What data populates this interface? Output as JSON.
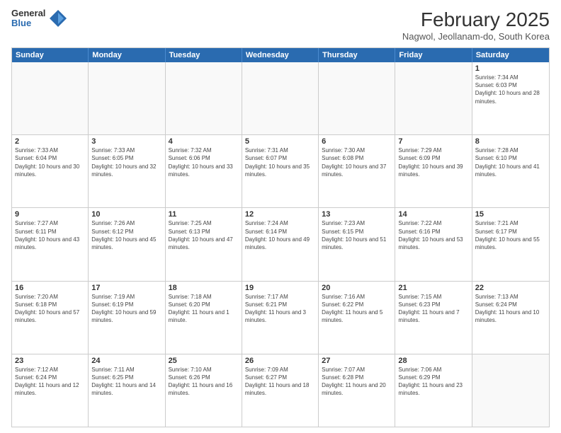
{
  "header": {
    "logo": {
      "general": "General",
      "blue": "Blue"
    },
    "title": "February 2025",
    "location": "Nagwol, Jeollanam-do, South Korea"
  },
  "calendar": {
    "weekdays": [
      "Sunday",
      "Monday",
      "Tuesday",
      "Wednesday",
      "Thursday",
      "Friday",
      "Saturday"
    ],
    "rows": [
      [
        {
          "day": "",
          "info": ""
        },
        {
          "day": "",
          "info": ""
        },
        {
          "day": "",
          "info": ""
        },
        {
          "day": "",
          "info": ""
        },
        {
          "day": "",
          "info": ""
        },
        {
          "day": "",
          "info": ""
        },
        {
          "day": "1",
          "info": "Sunrise: 7:34 AM\nSunset: 6:03 PM\nDaylight: 10 hours and 28 minutes."
        }
      ],
      [
        {
          "day": "2",
          "info": "Sunrise: 7:33 AM\nSunset: 6:04 PM\nDaylight: 10 hours and 30 minutes."
        },
        {
          "day": "3",
          "info": "Sunrise: 7:33 AM\nSunset: 6:05 PM\nDaylight: 10 hours and 32 minutes."
        },
        {
          "day": "4",
          "info": "Sunrise: 7:32 AM\nSunset: 6:06 PM\nDaylight: 10 hours and 33 minutes."
        },
        {
          "day": "5",
          "info": "Sunrise: 7:31 AM\nSunset: 6:07 PM\nDaylight: 10 hours and 35 minutes."
        },
        {
          "day": "6",
          "info": "Sunrise: 7:30 AM\nSunset: 6:08 PM\nDaylight: 10 hours and 37 minutes."
        },
        {
          "day": "7",
          "info": "Sunrise: 7:29 AM\nSunset: 6:09 PM\nDaylight: 10 hours and 39 minutes."
        },
        {
          "day": "8",
          "info": "Sunrise: 7:28 AM\nSunset: 6:10 PM\nDaylight: 10 hours and 41 minutes."
        }
      ],
      [
        {
          "day": "9",
          "info": "Sunrise: 7:27 AM\nSunset: 6:11 PM\nDaylight: 10 hours and 43 minutes."
        },
        {
          "day": "10",
          "info": "Sunrise: 7:26 AM\nSunset: 6:12 PM\nDaylight: 10 hours and 45 minutes."
        },
        {
          "day": "11",
          "info": "Sunrise: 7:25 AM\nSunset: 6:13 PM\nDaylight: 10 hours and 47 minutes."
        },
        {
          "day": "12",
          "info": "Sunrise: 7:24 AM\nSunset: 6:14 PM\nDaylight: 10 hours and 49 minutes."
        },
        {
          "day": "13",
          "info": "Sunrise: 7:23 AM\nSunset: 6:15 PM\nDaylight: 10 hours and 51 minutes."
        },
        {
          "day": "14",
          "info": "Sunrise: 7:22 AM\nSunset: 6:16 PM\nDaylight: 10 hours and 53 minutes."
        },
        {
          "day": "15",
          "info": "Sunrise: 7:21 AM\nSunset: 6:17 PM\nDaylight: 10 hours and 55 minutes."
        }
      ],
      [
        {
          "day": "16",
          "info": "Sunrise: 7:20 AM\nSunset: 6:18 PM\nDaylight: 10 hours and 57 minutes."
        },
        {
          "day": "17",
          "info": "Sunrise: 7:19 AM\nSunset: 6:19 PM\nDaylight: 10 hours and 59 minutes."
        },
        {
          "day": "18",
          "info": "Sunrise: 7:18 AM\nSunset: 6:20 PM\nDaylight: 11 hours and 1 minute."
        },
        {
          "day": "19",
          "info": "Sunrise: 7:17 AM\nSunset: 6:21 PM\nDaylight: 11 hours and 3 minutes."
        },
        {
          "day": "20",
          "info": "Sunrise: 7:16 AM\nSunset: 6:22 PM\nDaylight: 11 hours and 5 minutes."
        },
        {
          "day": "21",
          "info": "Sunrise: 7:15 AM\nSunset: 6:23 PM\nDaylight: 11 hours and 7 minutes."
        },
        {
          "day": "22",
          "info": "Sunrise: 7:13 AM\nSunset: 6:24 PM\nDaylight: 11 hours and 10 minutes."
        }
      ],
      [
        {
          "day": "23",
          "info": "Sunrise: 7:12 AM\nSunset: 6:24 PM\nDaylight: 11 hours and 12 minutes."
        },
        {
          "day": "24",
          "info": "Sunrise: 7:11 AM\nSunset: 6:25 PM\nDaylight: 11 hours and 14 minutes."
        },
        {
          "day": "25",
          "info": "Sunrise: 7:10 AM\nSunset: 6:26 PM\nDaylight: 11 hours and 16 minutes."
        },
        {
          "day": "26",
          "info": "Sunrise: 7:09 AM\nSunset: 6:27 PM\nDaylight: 11 hours and 18 minutes."
        },
        {
          "day": "27",
          "info": "Sunrise: 7:07 AM\nSunset: 6:28 PM\nDaylight: 11 hours and 20 minutes."
        },
        {
          "day": "28",
          "info": "Sunrise: 7:06 AM\nSunset: 6:29 PM\nDaylight: 11 hours and 23 minutes."
        },
        {
          "day": "",
          "info": ""
        }
      ]
    ]
  }
}
